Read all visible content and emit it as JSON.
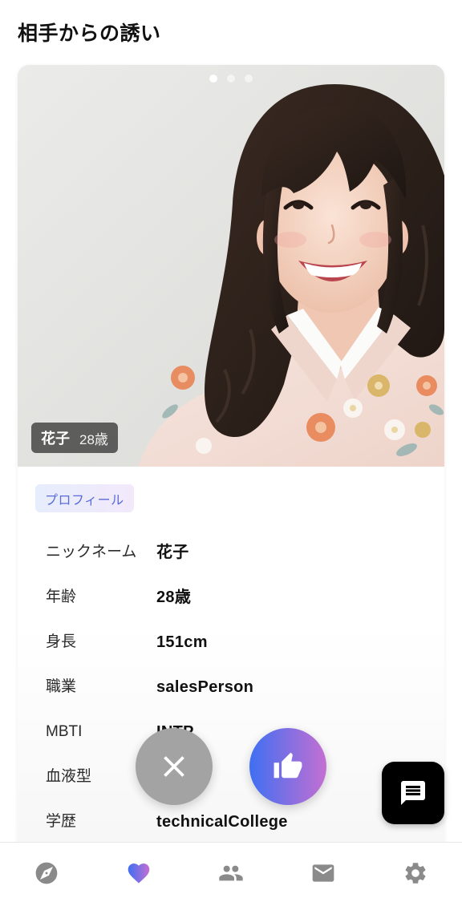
{
  "header": {
    "title": "相手からの誘い"
  },
  "photo": {
    "pagination": {
      "count": 3,
      "active": 0
    },
    "name": "花子",
    "age": "28歳"
  },
  "profile": {
    "tag": "プロフィール",
    "rows": [
      {
        "label": "ニックネーム",
        "value": "花子"
      },
      {
        "label": "年齢",
        "value": "28歳"
      },
      {
        "label": "身長",
        "value": "151cm"
      },
      {
        "label": "職業",
        "value": "salesPerson"
      },
      {
        "label": "MBTI",
        "value": "INTP"
      },
      {
        "label": "血液型"
      },
      {
        "label": "学歴",
        "value": "technicalCollege"
      }
    ]
  },
  "actions": {
    "dislike_icon": "close-icon",
    "like_icon": "thumb-up-icon",
    "chat_icon": "chat-icon"
  },
  "bottom_nav": {
    "items": [
      {
        "icon": "compass-icon",
        "active": false
      },
      {
        "icon": "heart-icon",
        "active": true
      },
      {
        "icon": "people-icon",
        "active": false
      },
      {
        "icon": "mail-icon",
        "active": false
      },
      {
        "icon": "gear-icon",
        "active": false
      }
    ]
  },
  "colors": {
    "accent_start": "#3f6ff2",
    "accent_end": "#c46fd2",
    "dislike": "#a3a3a3",
    "chat_fab": "#000000",
    "nav_icon": "#8a8a8a",
    "tag_text": "#5b6bd8"
  }
}
